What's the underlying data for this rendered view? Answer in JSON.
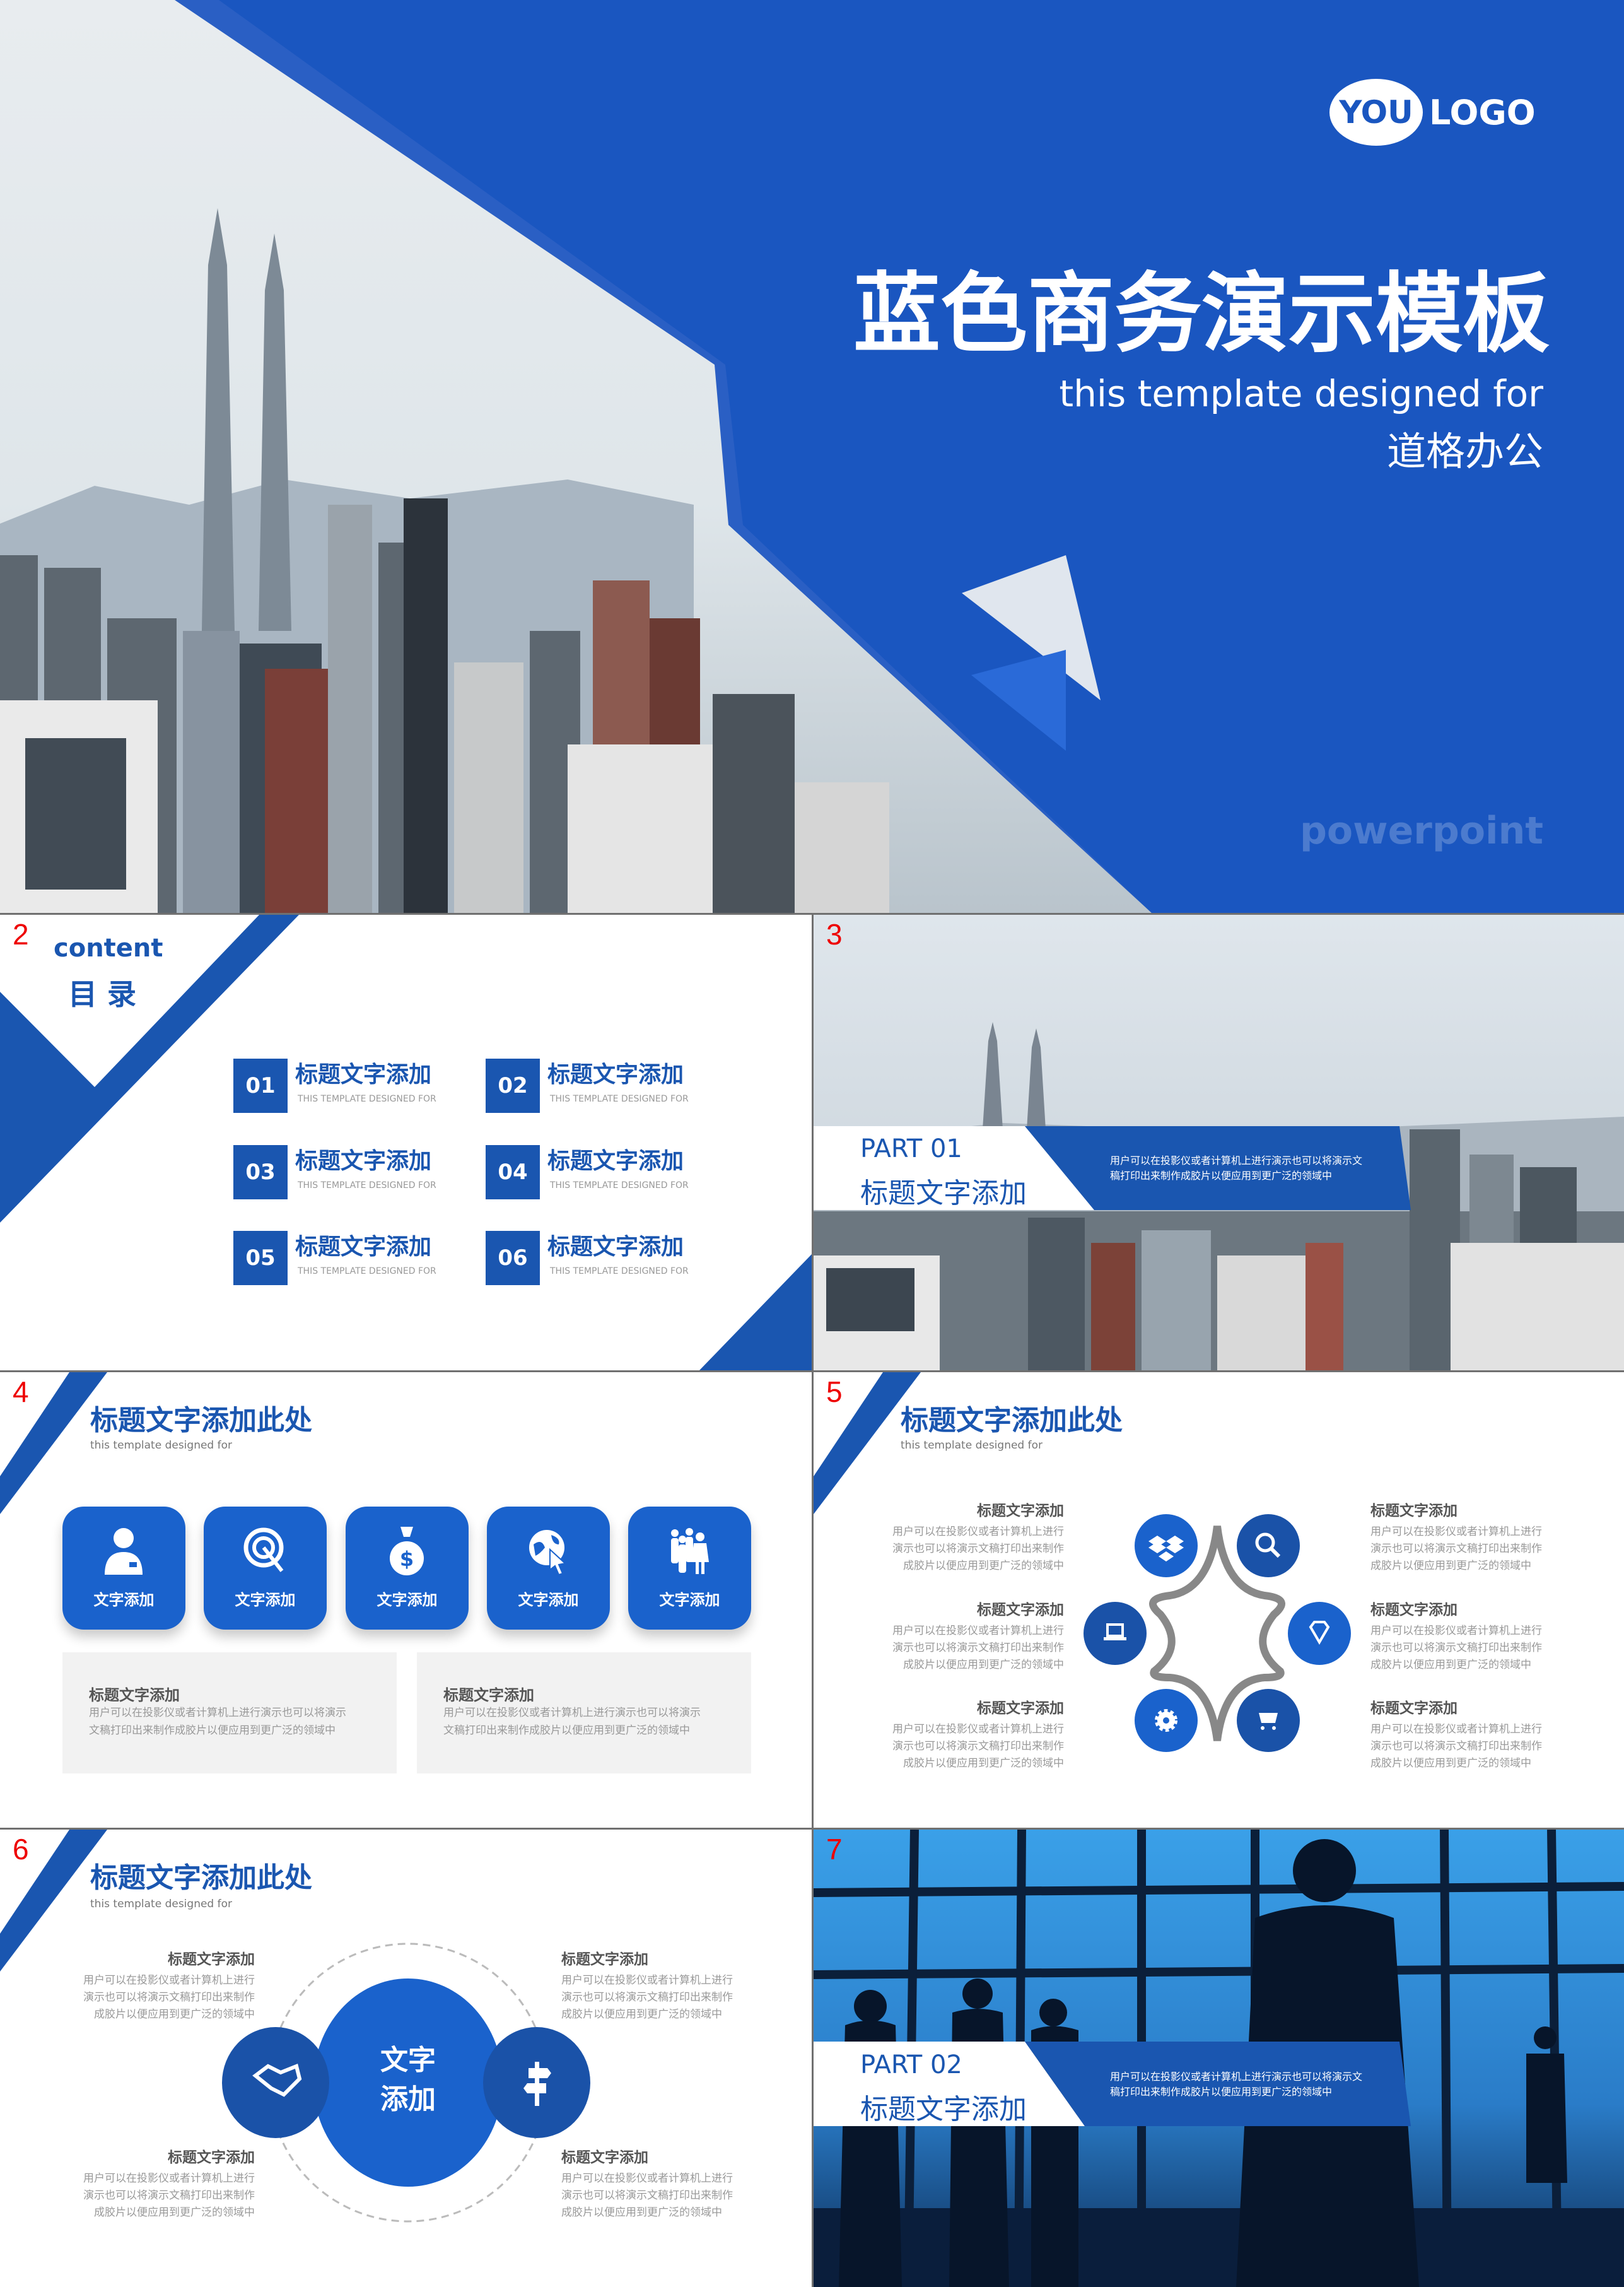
{
  "colors": {
    "brand_blue": "#1a56b0",
    "accent_blue": "#1a62cc",
    "slide_number": "#e00000"
  },
  "cover": {
    "logo_you": "YOU",
    "logo_text": "LOGO",
    "title": "蓝色商务演示模板",
    "subtitle_en": "this template designed for",
    "subtitle_cn": "道格办公",
    "watermark": "powerpoint"
  },
  "slide2": {
    "number": "2",
    "content_en": "content",
    "content_cn": "目 录",
    "items": [
      {
        "num": "01",
        "title": "标题文字添加",
        "sub": "THIS TEMPLATE DESIGNED FOR"
      },
      {
        "num": "02",
        "title": "标题文字添加",
        "sub": "THIS TEMPLATE DESIGNED FOR"
      },
      {
        "num": "03",
        "title": "标题文字添加",
        "sub": "THIS TEMPLATE DESIGNED FOR"
      },
      {
        "num": "04",
        "title": "标题文字添加",
        "sub": "THIS TEMPLATE DESIGNED FOR"
      },
      {
        "num": "05",
        "title": "标题文字添加",
        "sub": "THIS TEMPLATE DESIGNED FOR"
      },
      {
        "num": "06",
        "title": "标题文字添加",
        "sub": "THIS TEMPLATE DESIGNED FOR"
      }
    ]
  },
  "slide3": {
    "number": "3",
    "part": "PART 01",
    "title": "标题文字添加",
    "body": "用户可以在投影仪或者计算机上进行演示也可以将演示文\n稿打印出来制作成胶片以便应用到更广泛的领域中"
  },
  "slide4": {
    "number": "4",
    "title": "标题文字添加此处",
    "subtitle": "this template designed for",
    "cards": [
      {
        "icon": "businessman-icon",
        "label": "文字添加"
      },
      {
        "icon": "target-icon",
        "label": "文字添加"
      },
      {
        "icon": "money-bag-icon",
        "label": "文字添加"
      },
      {
        "icon": "globe-cursor-icon",
        "label": "文字添加"
      },
      {
        "icon": "people-group-icon",
        "label": "文字添加"
      }
    ],
    "boxes": [
      {
        "heading": "标题文字添加",
        "body": "用户可以在投影仪或者计算机上进行演示也可以将演示\n文稿打印出来制作成胶片以便应用到更广泛的领域中"
      },
      {
        "heading": "标题文字添加",
        "body": "用户可以在投影仪或者计算机上进行演示也可以将演示\n文稿打印出来制作成胶片以便应用到更广泛的领域中"
      }
    ]
  },
  "slide5": {
    "number": "5",
    "title": "标题文字添加此处",
    "subtitle": "this template designed for",
    "blocks": [
      {
        "heading": "标题文字添加",
        "body": "用户可以在投影仪或者计算机上进行\n演示也可以将演示文稿打印出来制作\n成胶片以便应用到更广泛的领域中"
      },
      {
        "heading": "标题文字添加",
        "body": "用户可以在投影仪或者计算机上进行\n演示也可以将演示文稿打印出来制作\n成胶片以便应用到更广泛的领域中"
      },
      {
        "heading": "标题文字添加",
        "body": "用户可以在投影仪或者计算机上进行\n演示也可以将演示文稿打印出来制作\n成胶片以便应用到更广泛的领域中"
      },
      {
        "heading": "标题文字添加",
        "body": "用户可以在投影仪或者计算机上进行\n演示也可以将演示文稿打印出来制作\n成胶片以便应用到更广泛的领域中"
      },
      {
        "heading": "标题文字添加",
        "body": "用户可以在投影仪或者计算机上进行\n演示也可以将演示文稿打印出来制作\n成胶片以便应用到更广泛的领域中"
      },
      {
        "heading": "标题文字添加",
        "body": "用户可以在投影仪或者计算机上进行\n演示也可以将演示文稿打印出来制作\n成胶片以便应用到更广泛的领域中"
      }
    ],
    "icons": [
      "dropbox-icon",
      "search-icon",
      "laptop-icon",
      "diamond-icon",
      "gear-icon",
      "cart-icon"
    ]
  },
  "slide6": {
    "number": "6",
    "title": "标题文字添加此处",
    "subtitle": "this template designed for",
    "center_line1": "文字",
    "center_line2": "添加",
    "icons": [
      "handshake-icon",
      "signpost-icon"
    ],
    "blocks": [
      {
        "heading": "标题文字添加",
        "body": "用户可以在投影仪或者计算机上进行\n演示也可以将演示文稿打印出来制作\n成胶片以便应用到更广泛的领域中"
      },
      {
        "heading": "标题文字添加",
        "body": "用户可以在投影仪或者计算机上进行\n演示也可以将演示文稿打印出来制作\n成胶片以便应用到更广泛的领域中"
      },
      {
        "heading": "标题文字添加",
        "body": "用户可以在投影仪或者计算机上进行\n演示也可以将演示文稿打印出来制作\n成胶片以便应用到更广泛的领域中"
      },
      {
        "heading": "标题文字添加",
        "body": "用户可以在投影仪或者计算机上进行\n演示也可以将演示文稿打印出来制作\n成胶片以便应用到更广泛的领域中"
      }
    ]
  },
  "slide7": {
    "number": "7",
    "part": "PART 02",
    "title": "标题文字添加",
    "body": "用户可以在投影仪或者计算机上进行演示也可以将演示文\n稿打印出来制作成胶片以便应用到更广泛的领域中"
  }
}
